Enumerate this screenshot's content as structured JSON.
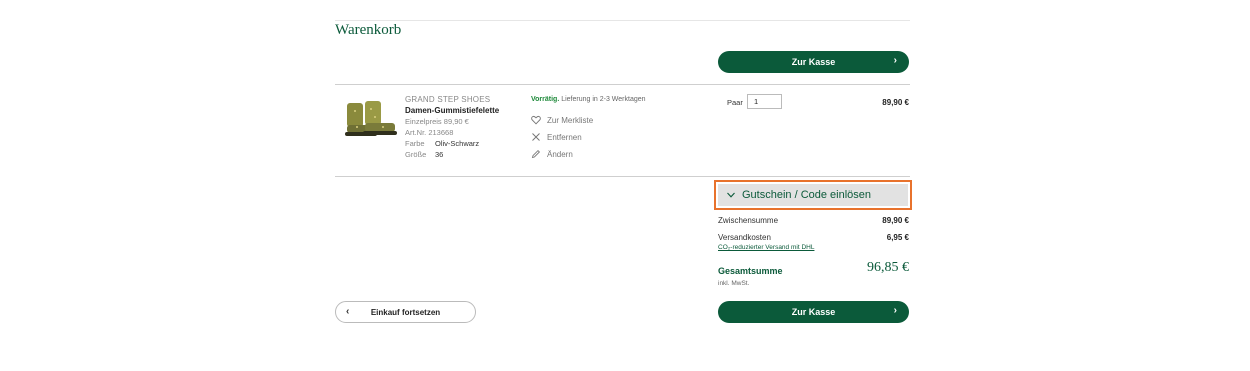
{
  "page": {
    "title": "Warenkorb"
  },
  "checkout_button": {
    "label": "Zur Kasse"
  },
  "item": {
    "brand": "GRAND STEP SHOES",
    "name": "Damen-Gummistiefelette",
    "unit_price": "Einzelpreis 89,90 €",
    "article_no": "Art.Nr. 213668",
    "color_label": "Farbe",
    "color_value": "Oliv-Schwarz",
    "size_label": "Größe",
    "size_value": "36",
    "availability_status": "Vorrätig.",
    "availability_text": " Lieferung in 2-3 Werktagen",
    "actions": {
      "wishlist": "Zur Merkliste",
      "remove": "Entfernen",
      "edit": "Ändern"
    },
    "qty_label": "Paar",
    "qty_value": "1",
    "price": "89,90 €"
  },
  "voucher": {
    "label": "Gutschein / Code einlösen"
  },
  "summary": {
    "subtotal_label": "Zwischensumme",
    "subtotal_value": "89,90 €",
    "shipping_label": "Versandkosten",
    "shipping_value": "6,95 €",
    "shipping_note": "CO₂-reduzierter Versand mit DHL",
    "total_label": "Gesamtsumme",
    "total_value": "96,85 €",
    "tax_note": "inkl. MwSt."
  },
  "continue_button": {
    "label": "Einkauf fortsetzen"
  },
  "colors": {
    "brand_green": "#0b5a3a",
    "highlight_orange": "#e8722c",
    "stock_green": "#1f8a3b"
  }
}
